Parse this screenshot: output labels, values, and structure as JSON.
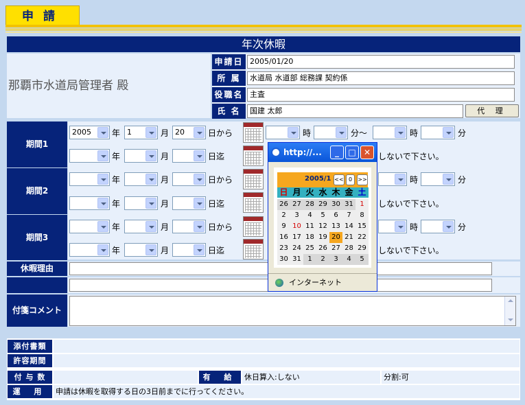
{
  "tab": {
    "label": "申請"
  },
  "form": {
    "title": "年次休暇",
    "addressee": "那覇市水道局管理者 殿",
    "apply_date_label": "申請日",
    "apply_date_value": "2005/01/20",
    "affiliation_label": "所 属",
    "affiliation_value": "水道局 水道部 総務課 契約係",
    "position_label": "役職名",
    "position_value": "主査",
    "name_label": "氏 名",
    "name_value": "国建 太郎",
    "proxy_button": "代 理"
  },
  "periods": [
    {
      "label": "期間1",
      "from_year": "2005",
      "from_month": "1",
      "from_day": "20"
    },
    {
      "label": "期間2"
    },
    {
      "label": "期間3"
    }
  ],
  "units": {
    "year": "年",
    "month": "月",
    "from": "日から",
    "to": "日迄",
    "hour": "時",
    "minute_range": "分～",
    "minute": "分",
    "note": "しないで下さい。"
  },
  "reason_label": "休暇理由",
  "comment_label": "付箋コメント",
  "popup": {
    "title": "http://...",
    "month_label": "2005/1",
    "prev_button": "<<",
    "today_button": "0",
    "next_button": ">>",
    "weekdays": [
      "日",
      "月",
      "火",
      "水",
      "木",
      "金",
      "土"
    ],
    "weekday_colors": [
      "#d40000",
      "#000000",
      "#000000",
      "#000000",
      "#000000",
      "#000000",
      "#0000cc"
    ],
    "days": [
      [
        "26",
        "27",
        "28",
        "29",
        "30",
        "31",
        "1"
      ],
      [
        "2",
        "3",
        "4",
        "5",
        "6",
        "7",
        "8"
      ],
      [
        "9",
        "10",
        "11",
        "12",
        "13",
        "14",
        "15"
      ],
      [
        "16",
        "17",
        "18",
        "19",
        "20",
        "21",
        "22"
      ],
      [
        "23",
        "24",
        "25",
        "26",
        "27",
        "28",
        "29"
      ],
      [
        "30",
        "31",
        "1",
        "2",
        "3",
        "4",
        "5"
      ]
    ],
    "status_text": "インターネット"
  },
  "bottom": {
    "attachments_label": "添付書類",
    "allowed_period_label": "許容期間",
    "grant_label": "付 与 数",
    "paid_label": "有 給",
    "holiday_count": "休日算入:しない",
    "split": "分割:可",
    "operation_label": "運 用",
    "operation_text": "申請は休暇を取得する日の3日前までに行ってください。"
  },
  "colors": {
    "navy": "#06237a",
    "tab_yellow": "#ffe000",
    "calendar_orange": "#f6a71f",
    "weekday_teal": "#34b0c0"
  }
}
